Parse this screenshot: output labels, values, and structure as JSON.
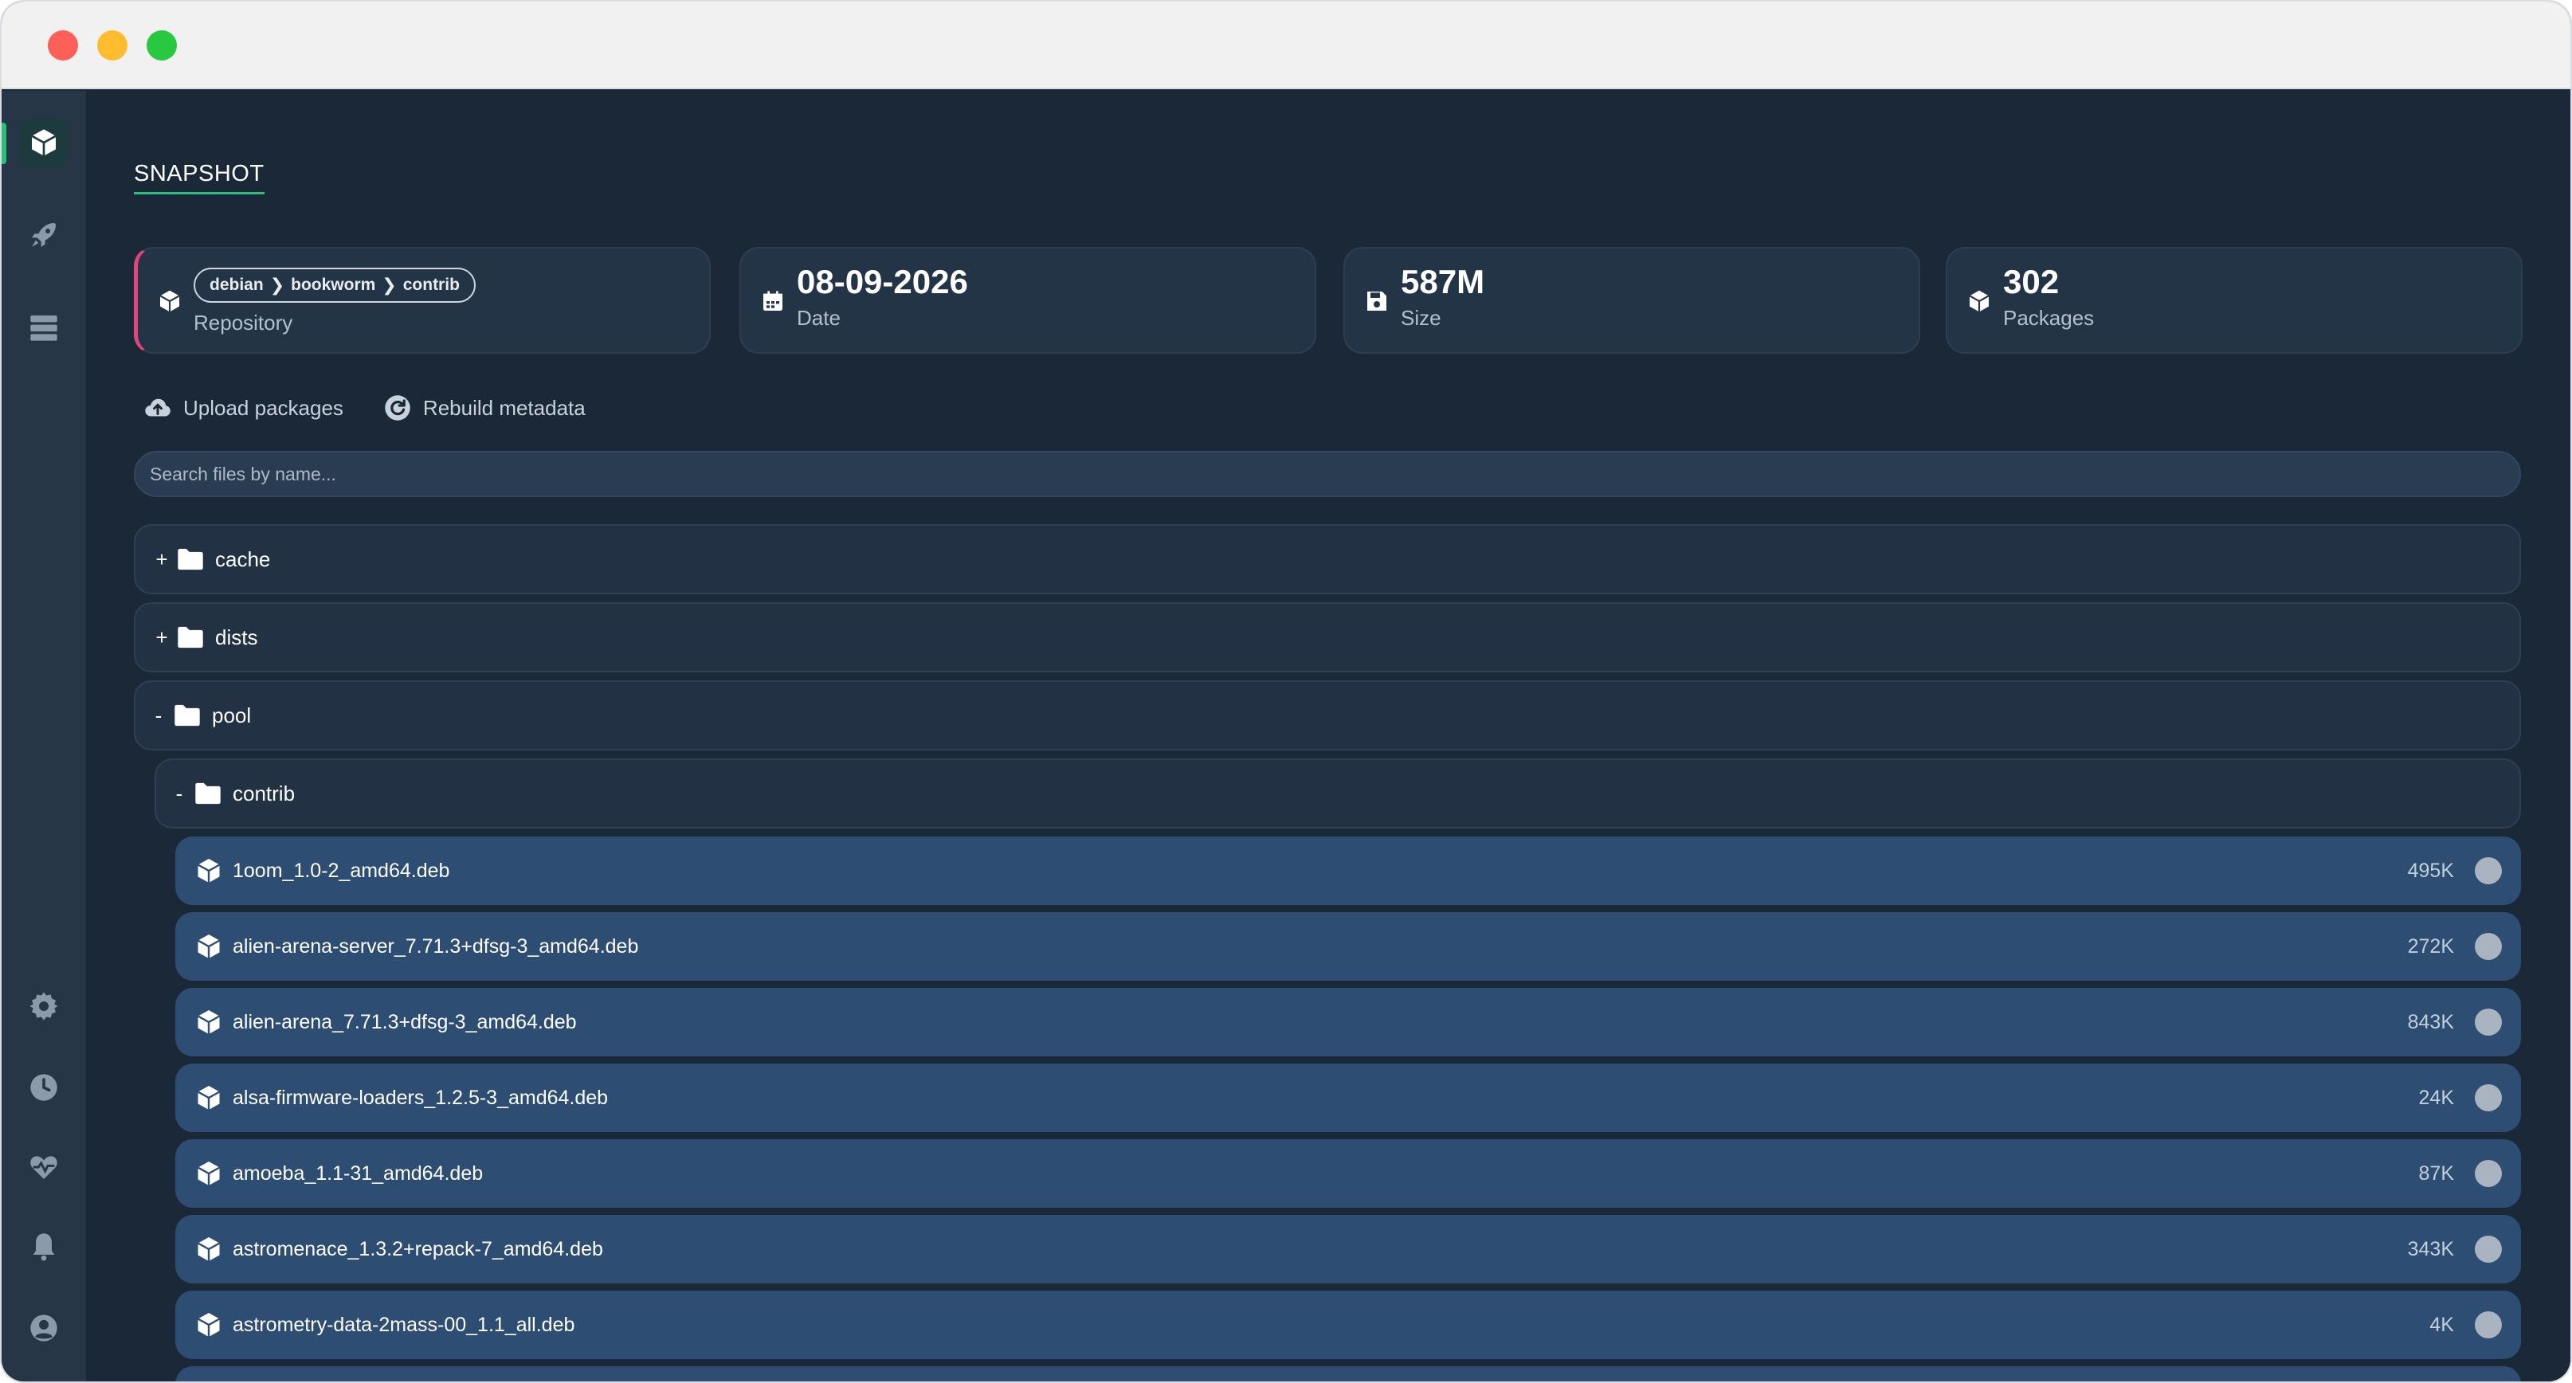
{
  "window": {
    "controls": [
      "close",
      "minimize",
      "maximize"
    ]
  },
  "sidebar": {
    "top_items": [
      {
        "icon": "package-icon",
        "active": true
      },
      {
        "icon": "rocket-icon",
        "active": false
      },
      {
        "icon": "server-icon",
        "active": false
      }
    ],
    "bottom_items": [
      {
        "icon": "gear-icon"
      },
      {
        "icon": "clock-icon"
      },
      {
        "icon": "heartbeat-icon"
      },
      {
        "icon": "bell-icon"
      },
      {
        "icon": "user-icon"
      }
    ],
    "accent": "#2bbf7a"
  },
  "page": {
    "tab": "SNAPSHOT"
  },
  "cards": {
    "repository": {
      "crumbs": [
        "debian",
        "bookworm",
        "contrib"
      ],
      "separator": "❯",
      "label": "Repository",
      "accent": "#e0457b"
    },
    "date": {
      "value": "08-09-2026",
      "label": "Date"
    },
    "size": {
      "value": "587M",
      "label": "Size"
    },
    "packages": {
      "value": "302",
      "label": "Packages"
    }
  },
  "actions": {
    "upload": "Upload packages",
    "rebuild": "Rebuild metadata"
  },
  "search": {
    "placeholder": "Search files by name...",
    "value": ""
  },
  "tree": {
    "folders": [
      {
        "toggle": "+",
        "name": "cache"
      },
      {
        "toggle": "+",
        "name": "dists"
      },
      {
        "toggle": "-",
        "name": "pool"
      },
      {
        "toggle": "-",
        "name": "contrib"
      }
    ],
    "files": [
      {
        "name": "1oom_1.0-2_amd64.deb",
        "size": "495K"
      },
      {
        "name": "alien-arena-server_7.71.3+dfsg-3_amd64.deb",
        "size": "272K"
      },
      {
        "name": "alien-arena_7.71.3+dfsg-3_amd64.deb",
        "size": "843K"
      },
      {
        "name": "alsa-firmware-loaders_1.2.5-3_amd64.deb",
        "size": "24K"
      },
      {
        "name": "amoeba_1.1-31_amd64.deb",
        "size": "87K"
      },
      {
        "name": "astromenace_1.3.2+repack-7_amd64.deb",
        "size": "343K"
      },
      {
        "name": "astrometry-data-2mass-00_1.1_all.deb",
        "size": "4K"
      }
    ]
  }
}
